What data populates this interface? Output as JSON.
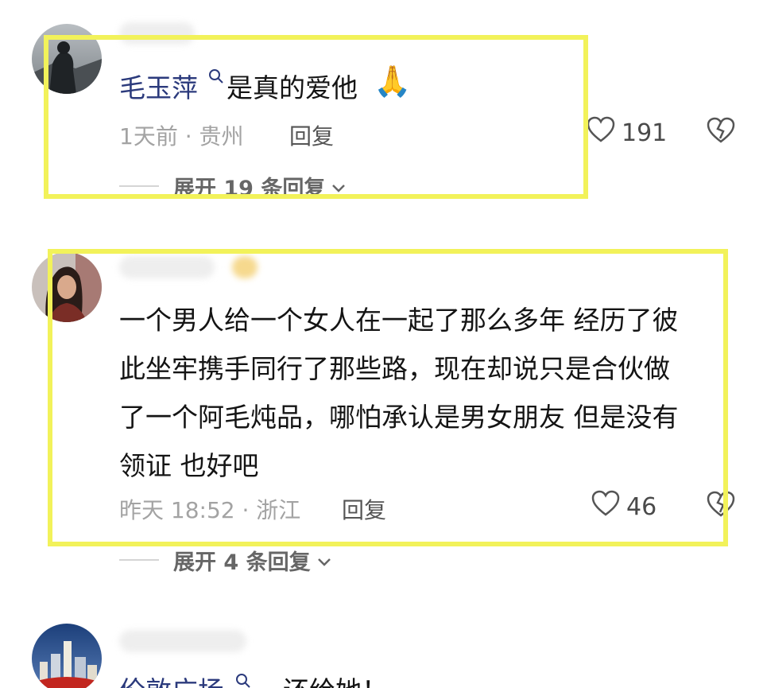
{
  "comments": [
    {
      "author": "毛玉萍",
      "text": "是真的爱他",
      "emoji": "🙏",
      "time_location": "1天前 · 贵州",
      "reply_label": "回复",
      "likes": "191",
      "expand_label": "展开 19 条回复"
    },
    {
      "text_lines": [
        "一个男人给一个女人在一起了那么多年 经历了彼",
        "此坐牢携手同行了那些路，现在却说只是合伙做",
        "了一个阿毛炖品，哪怕承认是男女朋友 但是没有",
        "领证 也好吧"
      ],
      "time_location": "昨天 18:52 · 浙江",
      "reply_label": "回复",
      "likes": "46",
      "expand_label": "展开 4 条回复"
    },
    {
      "author": "伦敦广场",
      "text": "还给她！"
    }
  ],
  "colors": {
    "author": "#2b3a7c",
    "highlight": "#f2f25a",
    "meta": "#a3a3a3"
  },
  "icons": [
    "search-icon",
    "pray-emoji",
    "heart-icon",
    "broken-heart-icon",
    "chevron-down-icon"
  ]
}
